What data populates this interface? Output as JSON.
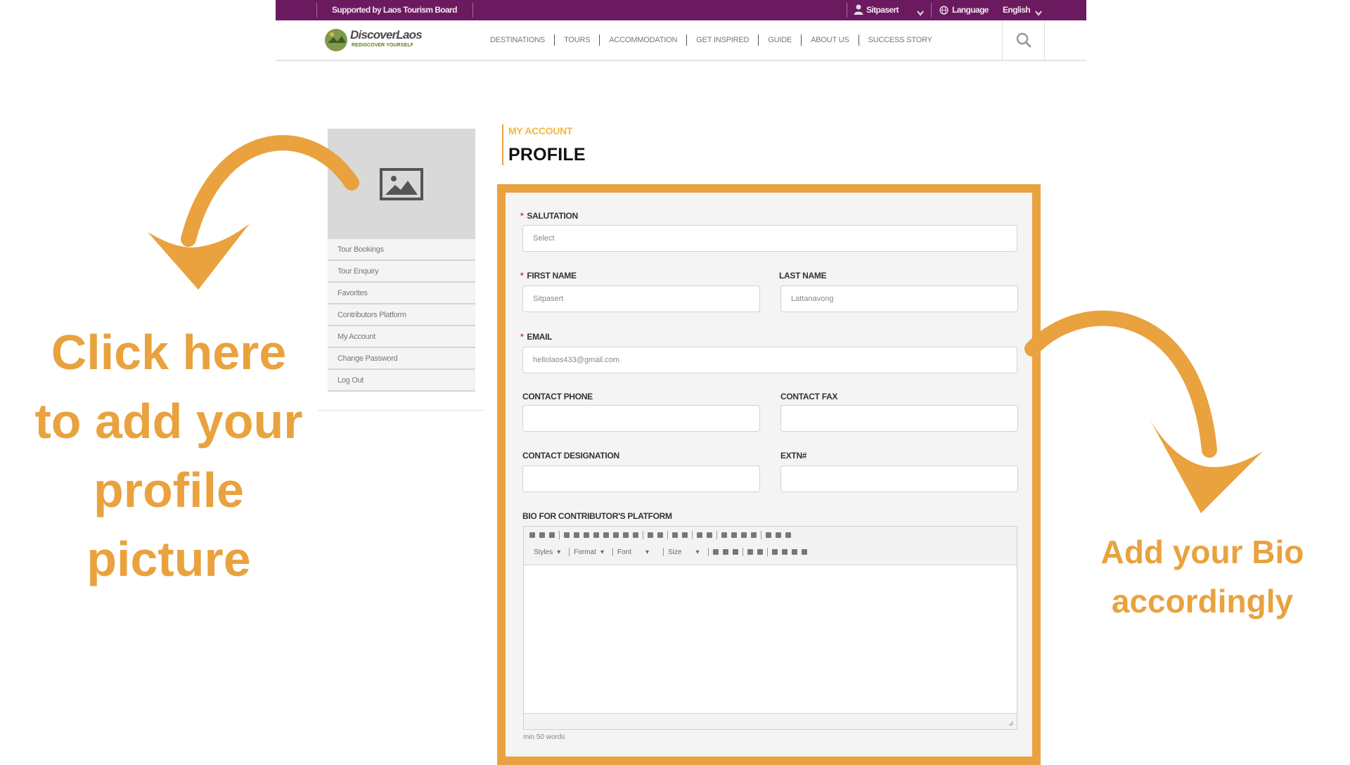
{
  "topbar": {
    "supported_by": "Supported by Laos Tourism Board",
    "user_name": "Sitpasert",
    "language_label": "Language",
    "language_value": "English"
  },
  "logo": {
    "name": "DiscoverLaos",
    "tagline": "REDISCOVER YOURSELF"
  },
  "nav": {
    "items": [
      "DESTINATIONS",
      "TOURS",
      "ACCOMMODATION",
      "GET INSPIRED",
      "GUIDE",
      "ABOUT US",
      "SUCCESS STORY"
    ]
  },
  "sidebar": {
    "items": [
      "Tour Bookings",
      "Tour Enquiry",
      "Favorites",
      "Contributors Platform",
      "My Account",
      "Change Password",
      "Log Out"
    ]
  },
  "header": {
    "section": "MY ACCOUNT",
    "title": "PROFILE"
  },
  "form": {
    "salutation": {
      "label": "SALUTATION",
      "value": "Select"
    },
    "first_name": {
      "label": "FIRST NAME",
      "value": "Sitpasert"
    },
    "last_name": {
      "label": "LAST NAME",
      "value": "Lattanavong"
    },
    "email": {
      "label": "EMAIL",
      "value": "hellolaos433@gmail.com"
    },
    "contact_phone": {
      "label": "CONTACT PHONE",
      "value": ""
    },
    "contact_fax": {
      "label": "CONTACT FAX",
      "value": ""
    },
    "contact_designation": {
      "label": "CONTACT DESIGNATION",
      "value": ""
    },
    "extn": {
      "label": "EXTN#",
      "value": ""
    },
    "bio": {
      "label": "BIO FOR CONTRIBUTOR'S PLATFORM",
      "toolbar_styles": "Styles",
      "toolbar_format": "Format",
      "toolbar_font": "Font",
      "toolbar_size": "Size",
      "hint": "min 50 words"
    }
  },
  "callouts": {
    "left": [
      "Click here",
      "to add your",
      "profile",
      "picture"
    ],
    "right": [
      "Add your Bio",
      "accordingly"
    ]
  },
  "colors": {
    "accent": "#eaa23f",
    "topbar": "#6b1a5f"
  }
}
